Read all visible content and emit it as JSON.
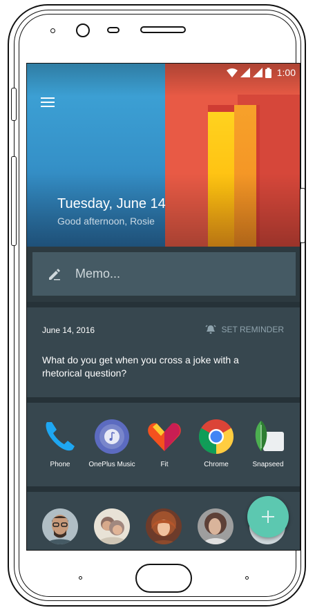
{
  "status_bar": {
    "time": "1:00"
  },
  "header": {
    "date": "Tuesday, June 14",
    "greeting": "Good afternoon, Rosie"
  },
  "memo": {
    "placeholder": "Memo..."
  },
  "reminder_card": {
    "date": "June 14, 2016",
    "action_label": "SET REMINDER",
    "text": "What do you get when you cross a joke with a rhetorical question?"
  },
  "apps": [
    {
      "label": "Phone",
      "icon": "phone-icon"
    },
    {
      "label": "OnePlus Music",
      "icon": "music-icon"
    },
    {
      "label": "Fit",
      "icon": "fit-icon"
    },
    {
      "label": "Chrome",
      "icon": "chrome-icon"
    },
    {
      "label": "Snapseed",
      "icon": "snapseed-icon"
    }
  ],
  "contacts": {
    "count_visible": 5
  },
  "fab": {
    "icon": "plus-icon"
  },
  "colors": {
    "panel": "#37474f",
    "memo": "#455a64",
    "fab": "#5cc8b0",
    "hero_blue": "#3591c8",
    "hero_red": "#e85a45"
  }
}
